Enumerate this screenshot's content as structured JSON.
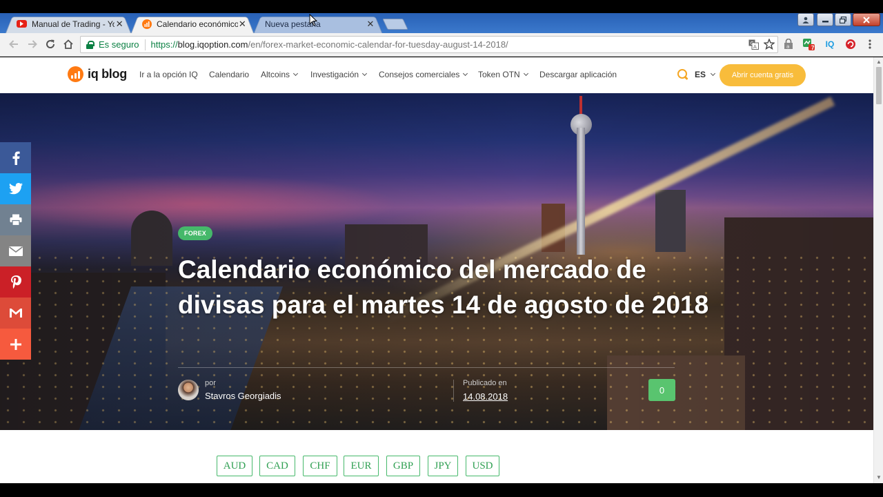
{
  "browser": {
    "tabs": [
      {
        "title": "Manual de Trading - You",
        "favicon": "youtube-icon",
        "favicon_color": "#e62117",
        "state": "inactive"
      },
      {
        "title": "Calendario económico de",
        "favicon": "iqoption-icon",
        "favicon_color": "#ff7a12",
        "state": "active"
      },
      {
        "title": "Nueva pestaña",
        "favicon": "none",
        "state": "inactive-faded"
      }
    ],
    "address": {
      "secure_label": "Es seguro",
      "scheme": "https://",
      "host": "blog.iqoption.com",
      "path": "/en/forex-market-economic-calendar-for-tuesday-august-14-2018/"
    },
    "extensions": [
      {
        "name": "translate-icon"
      },
      {
        "name": "bookmark-star-icon"
      },
      {
        "name": "extension-lock-icon"
      },
      {
        "name": "extension-green-badge-icon",
        "badge": "7"
      },
      {
        "name": "iq-extension-icon",
        "label": "IQ"
      },
      {
        "name": "red-extension-icon"
      },
      {
        "name": "chrome-menu-icon"
      }
    ]
  },
  "site": {
    "logo_text": "iq blog",
    "nav": [
      {
        "label": "Ir a la opción IQ",
        "dropdown": false
      },
      {
        "label": "Calendario",
        "dropdown": false
      },
      {
        "label": "Altcoins",
        "dropdown": true
      },
      {
        "label": "Investigación",
        "dropdown": true
      },
      {
        "label": "Consejos comerciales",
        "dropdown": true
      },
      {
        "label": "Token OTN",
        "dropdown": true
      },
      {
        "label": "Descargar aplicación",
        "dropdown": false
      }
    ],
    "language": "ES",
    "cta_label": "Abrir cuenta gratis",
    "accent_color": "#f8bc3b",
    "brand_color": "#ff7a12"
  },
  "article": {
    "category": "FOREX",
    "title": "Calendario económico del mercado de divisas para el martes 14 de agosto de 2018",
    "by_label": "por",
    "author": "Stavros Georgiadis",
    "published_label": "Publicado en",
    "published_date": "14.08.2018",
    "comment_count": "0",
    "currencies": [
      "AUD",
      "CAD",
      "CHF",
      "EUR",
      "GBP",
      "JPY",
      "USD"
    ]
  },
  "share": [
    {
      "network": "facebook",
      "color": "#3b5998"
    },
    {
      "network": "twitter",
      "color": "#1da1f2"
    },
    {
      "network": "print",
      "color": "#718191"
    },
    {
      "network": "email",
      "color": "#848484"
    },
    {
      "network": "pinterest",
      "color": "#cb2027"
    },
    {
      "network": "gmail",
      "color": "#dd4b39"
    },
    {
      "network": "more",
      "color": "#f65a3e"
    }
  ]
}
